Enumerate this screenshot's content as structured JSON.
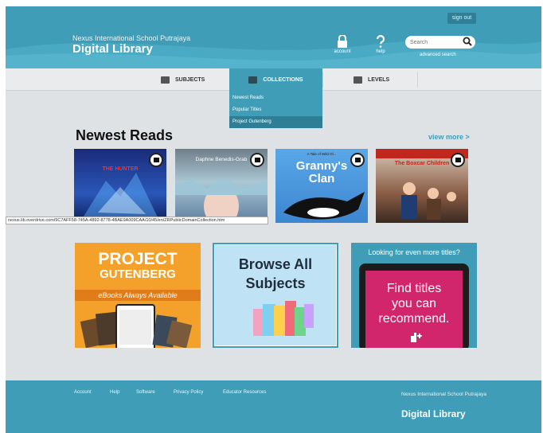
{
  "header": {
    "school_name": "Nexus International School Putrajaya",
    "library_name": "Digital Library",
    "signout_label": "sign out",
    "account_label": "account",
    "help_label": "help",
    "search_placeholder": "Search",
    "advanced_search_label": "advanced search"
  },
  "nav": {
    "items": [
      {
        "label": "SUBJECTS",
        "icon": "book-icon"
      },
      {
        "label": "COLLECTIONS",
        "icon": "folder-icon"
      },
      {
        "label": "LEVELS",
        "icon": "level-icon"
      }
    ],
    "dropdown": [
      "Newest Reads",
      "Popular Titles",
      "Project Gutenberg"
    ]
  },
  "newest": {
    "title": "Newest Reads",
    "view_more": "view more >",
    "books": [
      {
        "title": "THE HUNTER",
        "icon": "book-badge-icon"
      },
      {
        "title": "Daphne Benedis-Grab",
        "icon": "book-badge-icon"
      },
      {
        "title": "Granny's Clan",
        "tagline": "A Tale of Wild Ol...",
        "icon": "book-badge-icon"
      },
      {
        "title": "The Boxcar Children",
        "icon": "book-badge-icon"
      }
    ]
  },
  "status_url": "nexus.lib.overdrive.com/9C7AFF58-745A-4892-8778-4BAE9A009CAA/10/45/en/ZRPublicDomainCollection.htm",
  "tiles": {
    "gutenberg": {
      "line1": "PROJECT",
      "line2": "GUTENBERG",
      "line3": "eBooks Always Available"
    },
    "browse": {
      "line1": "Browse All",
      "line2": "Subjects"
    },
    "recommend": {
      "heading": "Looking for even more titles?",
      "line1": "Find titles",
      "line2": "you can",
      "line3": "recommend."
    }
  },
  "footer": {
    "links": [
      "Account",
      "Help",
      "Software",
      "Privacy Policy",
      "Educator Resources"
    ],
    "school_name": "Nexus International School Putrajaya",
    "library_name": "Digital Library"
  },
  "colors": {
    "primary": "#3f9db7",
    "accent_orange": "#f3a12a",
    "accent_pink": "#d1266b"
  }
}
